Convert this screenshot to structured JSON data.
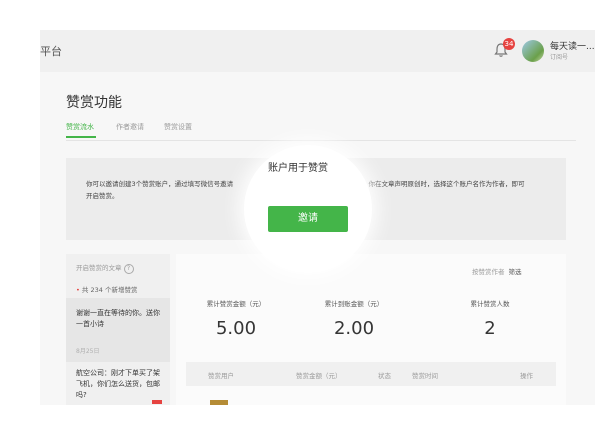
{
  "topbar": {
    "brand_fragment": "平台",
    "notification_count": "34",
    "account_name": "每天读一...",
    "account_type": "订阅号"
  },
  "page": {
    "title": "赞赏功能",
    "tabs": [
      "赞赏流水",
      "作者邀请",
      "赞赏设置"
    ],
    "active_tab": 0
  },
  "notice": {
    "line1": "你可以邀请创建3个赞赏账户，通过填写微信号邀请",
    "line1_end": "。你在文章声明原创时，选择这个账户名作为作者，即可",
    "line2": "开启赞赏。",
    "spotlight_text": "账户用于赞赏",
    "invite_label": "邀请"
  },
  "sidebar": {
    "header": "开启赞赏的文章",
    "help_glyph": "?",
    "count_text": "共 234 个新增赞赏",
    "items": [
      {
        "text": "谢谢一直在等待的你。送你一首小诗",
        "date": "8月25日"
      },
      {
        "text": "航空公司：刚才下单买了架飞机，你们怎么送货，包邮吗?"
      }
    ]
  },
  "stats": {
    "filter_label": "按赞赏作者",
    "filter_value": "筛选",
    "items": [
      {
        "label": "累计赞赏金额（元）",
        "value": "5.00"
      },
      {
        "label": "累计到账金额（元）",
        "value": "2.00"
      },
      {
        "label": "累计赞赏人数",
        "value": "2"
      }
    ]
  },
  "table": {
    "headers": [
      "赞赏用户",
      "赞赏金额（元）",
      "状态",
      "赞赏时间",
      "操作"
    ]
  },
  "colors": {
    "accent": "#44b549",
    "badge": "#e64340"
  }
}
